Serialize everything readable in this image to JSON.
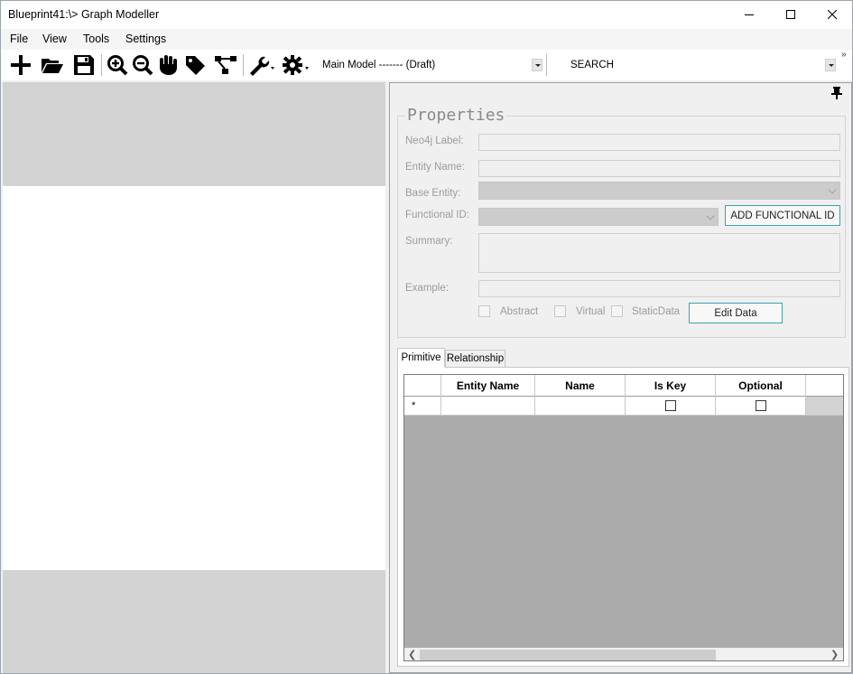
{
  "window": {
    "title": "Blueprint41:\\> Graph Modeller"
  },
  "menu": [
    "File",
    "View",
    "Tools",
    "Settings"
  ],
  "toolbar": {
    "model_dropdown": "Main Model ------- (Draft)",
    "search_dropdown": "SEARCH",
    "overflow": "»"
  },
  "properties": {
    "group_title": "Properties",
    "neo4j_label": "Neo4j Label:",
    "entity_name": "Entity Name:",
    "base_entity": "Base Entity:",
    "functional_id": "Functional ID:",
    "add_functional_id": "ADD FUNCTIONAL ID",
    "summary": "Summary:",
    "example": "Example:",
    "abstract": "Abstract",
    "virtual": "Virtual",
    "static_data": "StaticData",
    "edit_data": "Edit Data"
  },
  "tabs": [
    "Primitive",
    "Relationship"
  ],
  "grid": {
    "columns": [
      "Entity Name",
      "Name",
      "Is Key",
      "Optional"
    ],
    "new_row_marker": "*"
  },
  "colors": {
    "accent_button_border": "#37a4b4",
    "canvas_grey": "#d3d3d3",
    "grid_background": "#ababab"
  }
}
